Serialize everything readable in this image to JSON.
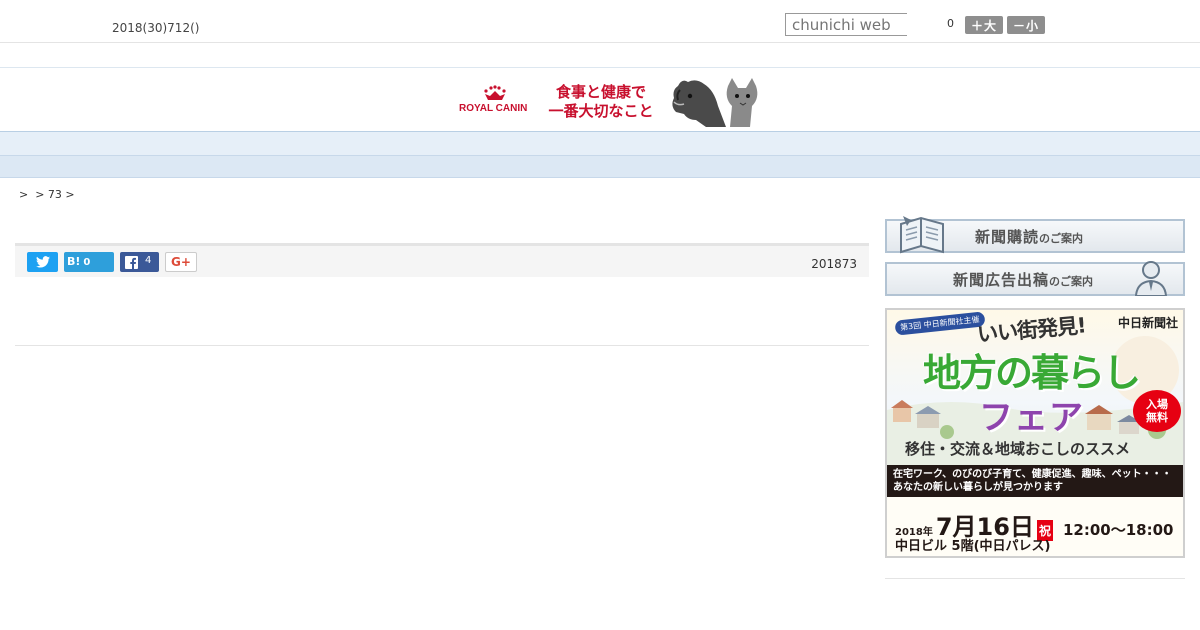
{
  "header": {
    "date": "2018(30)712()",
    "search_placeholder": "chunichi web",
    "font_size_count": "0",
    "font_larger": "＋大",
    "font_smaller": "－小"
  },
  "banner": {
    "brand": "ROYAL CANIN",
    "copy_line1": "食事と健康で",
    "copy_line2": "一番大切なこと",
    "brand_color": "#c8102e"
  },
  "nav": {
    "items": [
      "",
      "",
      "",
      "",
      "",
      "",
      "",
      "",
      ""
    ]
  },
  "breadcrumb": ">  > 73 >",
  "article": {
    "share": {
      "hatena_label": "B!",
      "hatena_count": "0",
      "facebook_count": "4",
      "gplus_label": "G+"
    },
    "published": "201873"
  },
  "sidebar": {
    "subscribe_main": "新聞購読",
    "subscribe_sub": "のご案内",
    "advertise_main": "新聞広告出稿",
    "advertise_sub": "のご案内"
  },
  "fair_ad": {
    "tag": "第3回 中日新聞社主催",
    "catch": "いい街発見!",
    "publisher": "中日新聞社",
    "title_line1": "地方の暮らし",
    "title_line2": "フェア",
    "free_line1": "入場",
    "free_line2": "無料",
    "subtitle": "移住・交流＆地域おこしのススメ",
    "desc_line1": "在宅ワーク、のびのび子育て、健康促進、趣味、ペット・・・",
    "desc_line2": "あなたの新しい暮らしが見つかります",
    "year": "2018年",
    "month_day": "7月16日",
    "holiday": "祝",
    "time": "12:00〜18:00",
    "venue": "中日ビル 5階(中日パレス)"
  }
}
